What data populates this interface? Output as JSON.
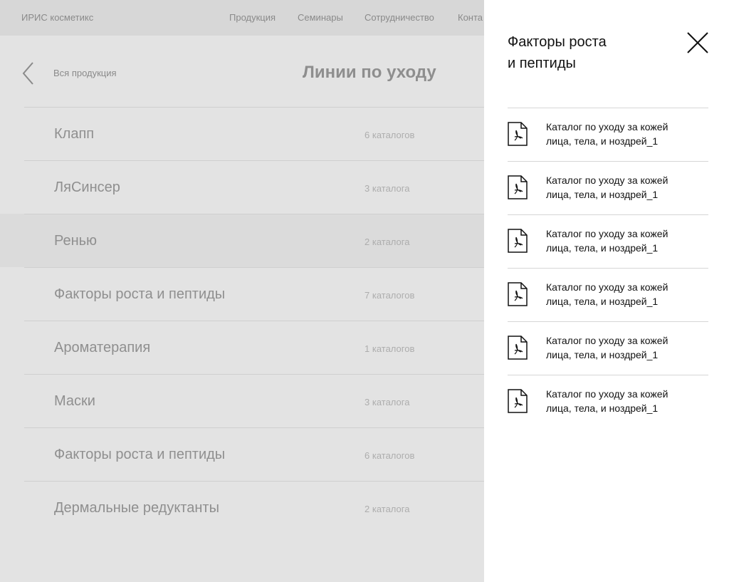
{
  "header": {
    "brand": "ИРИС косметикс",
    "nav": [
      "Продукция",
      "Семинары",
      "Сотрудничество",
      "Конта"
    ]
  },
  "toolbar": {
    "back_label": "Вся продукция",
    "title": "Линии по уходу"
  },
  "lines": [
    {
      "name": "Клапп",
      "count": "6 каталогов"
    },
    {
      "name": "ЛяСинсер",
      "count": "3 каталога"
    },
    {
      "name": "Ренью",
      "count": "2 каталога"
    },
    {
      "name": "Факторы роста и пептиды",
      "count": "7 каталогов"
    },
    {
      "name": "Ароматерапия",
      "count": "1 каталогов"
    },
    {
      "name": "Маски",
      "count": "3 каталога"
    },
    {
      "name": "Факторы роста и пептиды",
      "count": "6 каталогов"
    },
    {
      "name": "Дермальные редуктанты",
      "count": "2 каталога"
    }
  ],
  "drawer": {
    "title_line1": "Факторы роста",
    "title_line2": "и пептиды",
    "files": [
      {
        "line1": "Каталог по уходу за кожей",
        "line2": "лица, тела, и ноздрей_1"
      },
      {
        "line1": "Каталог по уходу за кожей",
        "line2": "лица, тела, и ноздрей_1"
      },
      {
        "line1": "Каталог по уходу за кожей",
        "line2": "лица, тела, и ноздрей_1"
      },
      {
        "line1": "Каталог по уходу за кожей",
        "line2": "лица, тела, и ноздрей_1"
      },
      {
        "line1": "Каталог по уходу за кожей",
        "line2": "лица, тела, и ноздрей_1"
      },
      {
        "line1": "Каталог по уходу за кожей",
        "line2": "лица, тела, и ноздрей_1"
      }
    ]
  },
  "icons": {
    "back": "chevron-left-icon",
    "close": "close-icon",
    "file": "pdf-file-icon"
  }
}
